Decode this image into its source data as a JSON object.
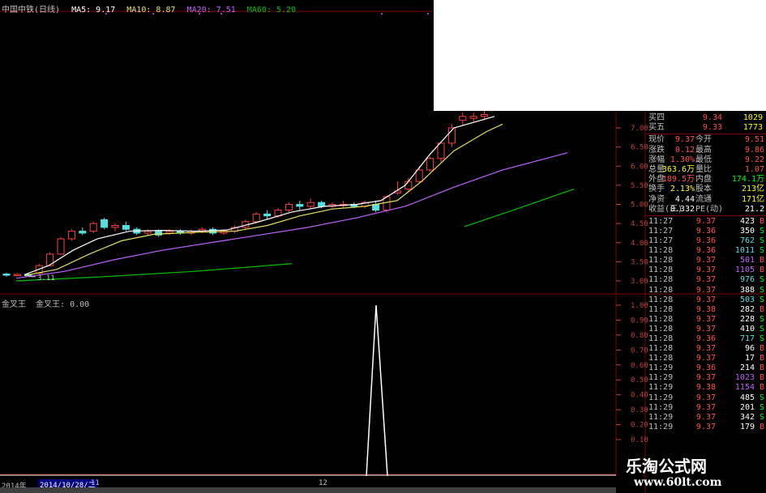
{
  "header": {
    "title": "中国中铁(日线)",
    "ma5": "MA5: 9.17",
    "ma10": "MA10: 8.87",
    "ma20": "MA20: 7.51",
    "ma60": "MA60: 5.20"
  },
  "indicator": {
    "name": "金叉王",
    "value": "金叉王: 0.00"
  },
  "price_axis": [
    "7.00",
    "6.50",
    "6.00",
    "5.50",
    "5.00",
    "4.50",
    "4.00",
    "3.50",
    "3.00"
  ],
  "indicator_axis": [
    "1.00",
    "0.90",
    "0.80",
    "0.70",
    "0.60",
    "0.50",
    "0.40",
    "0.30",
    "0.20",
    "0.10"
  ],
  "low_label": "3.11",
  "quote": {
    "bid_rows": [
      {
        "label": "买四",
        "price": "9.34",
        "vol": "1029"
      },
      {
        "label": "买五",
        "price": "9.33",
        "vol": "1773"
      }
    ],
    "stats": [
      {
        "l1": "现价",
        "v1": "9.37",
        "l2": "今开",
        "v2": "9.51",
        "c1": "red",
        "c2": "red"
      },
      {
        "l1": "涨跌",
        "v1": "0.12",
        "l2": "最高",
        "v2": "9.86",
        "c1": "red",
        "c2": "red"
      },
      {
        "l1": "涨幅",
        "v1": "1.30%",
        "l2": "最低",
        "v2": "9.22",
        "c1": "red",
        "c2": "red"
      },
      {
        "l1": "总量",
        "v1": "363.6万",
        "l2": "量比",
        "v2": "1.07",
        "c1": "yellow",
        "c2": "red"
      },
      {
        "l1": "外盘",
        "v1": "189.5万",
        "l2": "内盘",
        "v2": "174.1万",
        "c1": "red",
        "c2": "green"
      },
      {
        "l1": "换手",
        "v1": "2.13%",
        "l2": "股本",
        "v2": "213亿",
        "c1": "yellow",
        "c2": "yellow"
      },
      {
        "l1": "净资",
        "v1": "4.44",
        "l2": "流通",
        "v2": "171亿",
        "c1": "white",
        "c2": "yellow"
      },
      {
        "l1": "收益(三)",
        "v1": "0.332",
        "l2": "PE(动)",
        "v2": "21.2",
        "c1": "white",
        "c2": "white"
      }
    ],
    "ticks": [
      {
        "t": "11:27",
        "p": "9.37",
        "v": "423",
        "bs": "B"
      },
      {
        "t": "11:27",
        "p": "9.36",
        "v": "350",
        "bs": "S"
      },
      {
        "t": "11:27",
        "p": "9.36",
        "v": "762",
        "bs": "S"
      },
      {
        "t": "11:28",
        "p": "9.36",
        "v": "1011",
        "bs": "S"
      },
      {
        "t": "11:28",
        "p": "9.37",
        "v": "501",
        "bs": "B"
      },
      {
        "t": "11:28",
        "p": "9.37",
        "v": "1105",
        "bs": "B"
      },
      {
        "t": "11:28",
        "p": "9.37",
        "v": "976",
        "bs": "S"
      },
      {
        "t": "11:28",
        "p": "9.37",
        "v": "388",
        "bs": "S"
      },
      {
        "t": "11:28",
        "p": "9.37",
        "v": "503",
        "bs": "S"
      },
      {
        "t": "11:28",
        "p": "9.38",
        "v": "282",
        "bs": "B"
      },
      {
        "t": "11:28",
        "p": "9.37",
        "v": "228",
        "bs": "S"
      },
      {
        "t": "11:28",
        "p": "9.37",
        "v": "410",
        "bs": "S"
      },
      {
        "t": "11:28",
        "p": "9.36",
        "v": "717",
        "bs": "S"
      },
      {
        "t": "11:28",
        "p": "9.37",
        "v": "96",
        "bs": "B"
      },
      {
        "t": "11:28",
        "p": "9.37",
        "v": "17",
        "bs": "B"
      },
      {
        "t": "11:29",
        "p": "9.36",
        "v": "214",
        "bs": "B"
      },
      {
        "t": "11:29",
        "p": "9.37",
        "v": "1023",
        "bs": "B"
      },
      {
        "t": "11:29",
        "p": "9.38",
        "v": "1154",
        "bs": "B"
      },
      {
        "t": "11:29",
        "p": "9.37",
        "v": "485",
        "bs": "S"
      },
      {
        "t": "11:29",
        "p": "9.37",
        "v": "201",
        "bs": "S"
      },
      {
        "t": "11:29",
        "p": "9.37",
        "v": "342",
        "bs": "S"
      },
      {
        "t": "11:29",
        "p": "9.37",
        "v": "179",
        "bs": "B"
      }
    ]
  },
  "bottom": {
    "year": "2014年",
    "date": "2014/10/28/二",
    "mark_11": "11",
    "mark_12": "12"
  },
  "watermark": {
    "line1": "乐淘公式网",
    "line2": "www.60lt.com"
  },
  "colors": {
    "up": "#ff4040",
    "down": "#55e0e0",
    "ma5": "#ffffff",
    "ma10": "#e0e060",
    "ma20": "#c060ff",
    "ma60": "#00c000",
    "grid": "#800000"
  }
}
